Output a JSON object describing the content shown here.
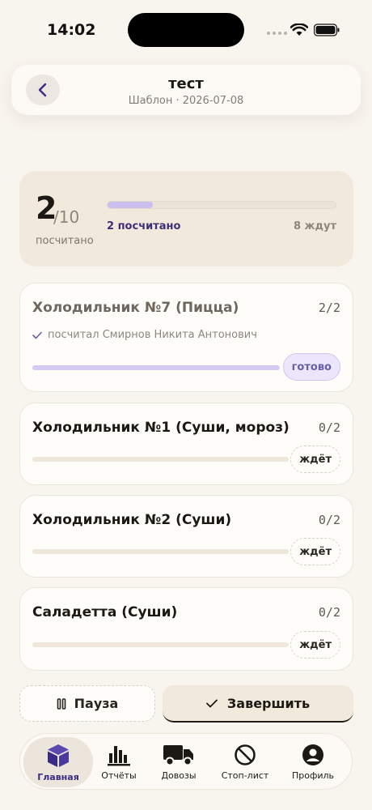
{
  "status_bar": {
    "time": "14:02"
  },
  "header": {
    "title": "тест",
    "subtitle": "Шаблон · 2026-07-08"
  },
  "summary": {
    "counted": "2",
    "total": "/10",
    "counted_label": "посчитано",
    "progress_fraction": 0.2,
    "counted_text": "2 посчитано",
    "waiting_text": "8 ждут"
  },
  "items": [
    {
      "name": "Холодильник №7 (Пицца)",
      "count": "2/2",
      "counted_by": "посчитал Смирнов Никита Антонович",
      "status": "готово",
      "progress_fraction": 1.0
    },
    {
      "name": "Холодильник №1 (Суши, мороз)",
      "count": "0/2",
      "status": "ждёт",
      "progress_fraction": 0
    },
    {
      "name": "Холодильник №2 (Суши)",
      "count": "0/2",
      "status": "ждёт",
      "progress_fraction": 0
    },
    {
      "name": "Саладетта (Суши)",
      "count": "0/2",
      "status": "ждёт",
      "progress_fraction": 0
    }
  ],
  "actions": {
    "pause_label": "Пауза",
    "finish_label": "Завершить"
  },
  "tabs": [
    {
      "label": "Главная",
      "icon": "box-icon",
      "active": true
    },
    {
      "label": "Отчёты",
      "icon": "bar-chart-icon",
      "active": false
    },
    {
      "label": "Довозы",
      "icon": "truck-icon",
      "active": false
    },
    {
      "label": "Стоп-лист",
      "icon": "prohibited-icon",
      "active": false
    },
    {
      "label": "Профиль",
      "icon": "profile-icon",
      "active": false
    }
  ],
  "colors": {
    "accent": "#3a2c86",
    "progress": "#cbbff0",
    "background": "#f8f4ee"
  }
}
